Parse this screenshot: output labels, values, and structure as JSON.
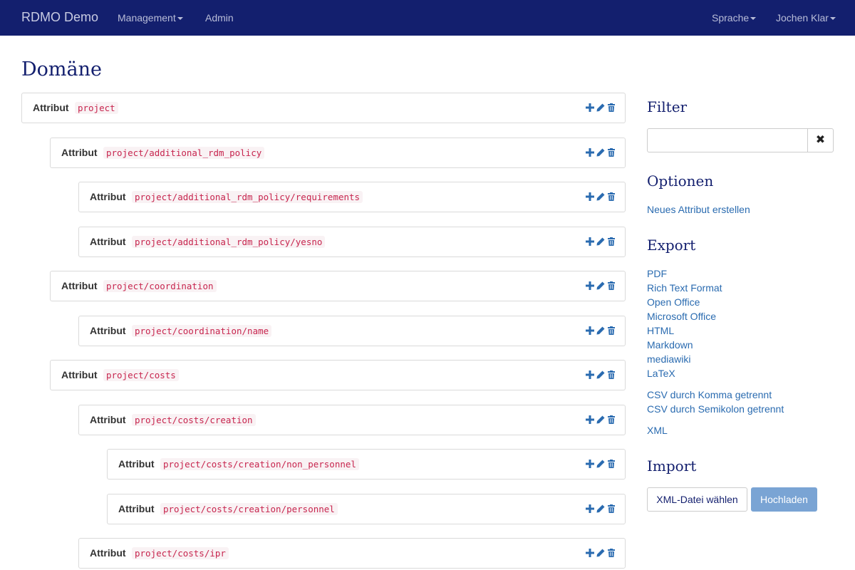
{
  "navbar": {
    "brand": "RDMO Demo",
    "management": "Management",
    "admin": "Admin",
    "language": "Sprache",
    "user": "Jochen Klar"
  },
  "page": {
    "title": "Domäne"
  },
  "attributes": [
    {
      "label": "Attribut",
      "path": "project"
    },
    {
      "label": "Attribut",
      "path": "project/additional_rdm_policy"
    },
    {
      "label": "Attribut",
      "path": "project/additional_rdm_policy/requirements"
    },
    {
      "label": "Attribut",
      "path": "project/additional_rdm_policy/yesno"
    },
    {
      "label": "Attribut",
      "path": "project/coordination"
    },
    {
      "label": "Attribut",
      "path": "project/coordination/name"
    },
    {
      "label": "Attribut",
      "path": "project/costs"
    },
    {
      "label": "Attribut",
      "path": "project/costs/creation"
    },
    {
      "label": "Attribut",
      "path": "project/costs/creation/non_personnel"
    },
    {
      "label": "Attribut",
      "path": "project/costs/creation/personnel"
    },
    {
      "label": "Attribut",
      "path": "project/costs/ipr"
    }
  ],
  "sidebar": {
    "filter": {
      "title": "Filter",
      "value": "",
      "placeholder": ""
    },
    "options": {
      "title": "Optionen",
      "create": "Neues Attribut erstellen"
    },
    "export": {
      "title": "Export",
      "items": [
        "PDF",
        "Rich Text Format",
        "Open Office",
        "Microsoft Office",
        "HTML",
        "Markdown",
        "mediawiki",
        "LaTeX"
      ],
      "csv_comma": "CSV durch Komma getrennt",
      "csv_semicolon": "CSV durch Semikolon getrennt",
      "xml": "XML"
    },
    "import": {
      "title": "Import",
      "choose_file": "XML-Datei wählen",
      "upload": "Hochladen"
    }
  },
  "colors": {
    "navbar": "#131f6e",
    "link": "#2a6bb0",
    "heading": "#131f6e",
    "code": "#c7254e"
  },
  "icons": [
    "plus-icon",
    "pencil-icon",
    "trash-icon",
    "close-icon",
    "caret-down-icon"
  ]
}
